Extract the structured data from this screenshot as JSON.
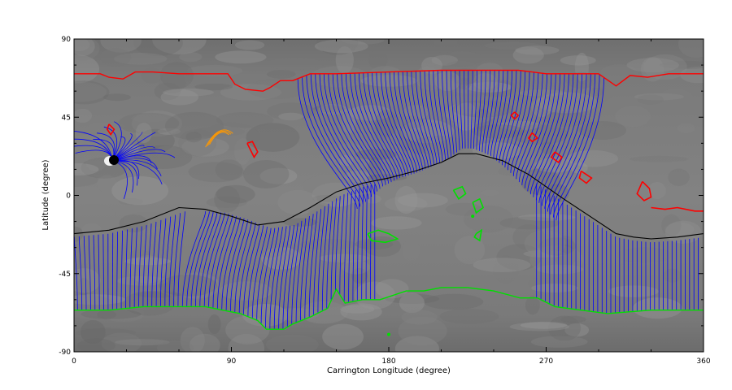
{
  "chart_data": {
    "type": "map-plot",
    "title": "",
    "xlabel": "Carrington Longitude (degree)",
    "ylabel": "Latitude (degree)",
    "xlim": [
      0,
      360
    ],
    "ylim": [
      -90,
      90
    ],
    "xticks": [
      0,
      90,
      180,
      270,
      360
    ],
    "yticks": [
      -90,
      -45,
      0,
      45,
      90
    ],
    "grid": false,
    "background": "grayscale magnetogram",
    "colors": {
      "open_field_lines": "#0000ff",
      "polarity_inversion_line": "#000000",
      "positive_polarity_coronal_hole": "#ff0000",
      "negative_polarity_coronal_hole": "#00e000",
      "closed_loops": "#ff9900"
    },
    "neutral_line": [
      [
        0,
        -22
      ],
      [
        20,
        -20
      ],
      [
        40,
        -15
      ],
      [
        60,
        -7
      ],
      [
        75,
        -8
      ],
      [
        90,
        -12
      ],
      [
        105,
        -17
      ],
      [
        120,
        -15
      ],
      [
        135,
        -7
      ],
      [
        150,
        2
      ],
      [
        165,
        7
      ],
      [
        180,
        10
      ],
      [
        195,
        14
      ],
      [
        210,
        19
      ],
      [
        220,
        24
      ],
      [
        230,
        24
      ],
      [
        245,
        20
      ],
      [
        260,
        12
      ],
      [
        270,
        5
      ],
      [
        280,
        -2
      ],
      [
        295,
        -12
      ],
      [
        310,
        -22
      ],
      [
        320,
        -24
      ],
      [
        330,
        -25
      ],
      [
        345,
        -24
      ],
      [
        360,
        -22
      ]
    ],
    "north_ch_boundary": [
      [
        0,
        70
      ],
      [
        15,
        70
      ],
      [
        20,
        68
      ],
      [
        28,
        67
      ],
      [
        35,
        71
      ],
      [
        45,
        71
      ],
      [
        60,
        70
      ],
      [
        75,
        70
      ],
      [
        88,
        70
      ],
      [
        92,
        64
      ],
      [
        98,
        61
      ],
      [
        108,
        60
      ],
      [
        112,
        62
      ],
      [
        118,
        66
      ],
      [
        125,
        66
      ],
      [
        135,
        70
      ],
      [
        150,
        70
      ],
      [
        180,
        71
      ],
      [
        210,
        72
      ],
      [
        240,
        72
      ],
      [
        254,
        72
      ],
      [
        262,
        71
      ],
      [
        270,
        70
      ],
      [
        285,
        70
      ],
      [
        300,
        70
      ],
      [
        310,
        63
      ],
      [
        318,
        69
      ],
      [
        328,
        68
      ],
      [
        340,
        70
      ],
      [
        360,
        70
      ]
    ],
    "south_ch_boundary": [
      [
        0,
        -66
      ],
      [
        20,
        -66
      ],
      [
        40,
        -64
      ],
      [
        60,
        -64
      ],
      [
        75,
        -64
      ],
      [
        85,
        -66
      ],
      [
        95,
        -68
      ],
      [
        105,
        -72
      ],
      [
        110,
        -77
      ],
      [
        120,
        -77
      ],
      [
        125,
        -74
      ],
      [
        135,
        -70
      ],
      [
        145,
        -65
      ],
      [
        150,
        -54
      ],
      [
        155,
        -62
      ],
      [
        165,
        -60
      ],
      [
        175,
        -60
      ],
      [
        190,
        -55
      ],
      [
        200,
        -55
      ],
      [
        210,
        -53
      ],
      [
        225,
        -53
      ],
      [
        240,
        -55
      ],
      [
        255,
        -59
      ],
      [
        265,
        -59
      ],
      [
        275,
        -64
      ],
      [
        290,
        -66
      ],
      [
        305,
        -68
      ],
      [
        330,
        -66
      ],
      [
        345,
        -66
      ],
      [
        360,
        -66
      ]
    ],
    "red_ch_contours": [
      [
        [
          20,
          41
        ],
        [
          23,
          38
        ],
        [
          21,
          35
        ],
        [
          19,
          38
        ],
        [
          20,
          41
        ]
      ],
      [
        [
          99,
          30
        ],
        [
          101,
          26
        ],
        [
          103,
          22
        ],
        [
          105,
          25
        ],
        [
          102,
          31
        ],
        [
          99,
          30
        ]
      ],
      [
        [
          252,
          48
        ],
        [
          254,
          46
        ],
        [
          252,
          44
        ],
        [
          250,
          46
        ],
        [
          252,
          48
        ]
      ],
      [
        [
          262,
          36
        ],
        [
          265,
          33
        ],
        [
          262,
          31
        ],
        [
          260,
          33
        ],
        [
          262,
          36
        ]
      ],
      [
        [
          275,
          25
        ],
        [
          279,
          22
        ],
        [
          277,
          19
        ],
        [
          273,
          22
        ],
        [
          275,
          25
        ]
      ],
      [
        [
          325,
          8
        ],
        [
          329,
          4
        ],
        [
          330,
          -1
        ],
        [
          326,
          -3
        ],
        [
          322,
          1
        ],
        [
          325,
          8
        ]
      ],
      [
        [
          290,
          14
        ],
        [
          296,
          10
        ],
        [
          293,
          7
        ],
        [
          289,
          10
        ],
        [
          290,
          14
        ]
      ],
      [
        [
          330,
          -7
        ],
        [
          338,
          -8
        ],
        [
          345,
          -7
        ],
        [
          355,
          -9
        ],
        [
          360,
          -9
        ]
      ]
    ],
    "green_ch_contours": [
      [
        [
          217,
          3
        ],
        [
          222,
          5
        ],
        [
          224,
          1
        ],
        [
          220,
          -2
        ],
        [
          217,
          3
        ]
      ],
      [
        [
          228,
          -4
        ],
        [
          232,
          -2
        ],
        [
          234,
          -7
        ],
        [
          230,
          -10
        ],
        [
          228,
          -4
        ]
      ],
      [
        [
          230,
          -22
        ],
        [
          233,
          -20
        ],
        [
          232,
          -26
        ],
        [
          229,
          -24
        ],
        [
          230,
          -22
        ]
      ],
      [
        [
          168,
          -22
        ],
        [
          174,
          -20
        ],
        [
          180,
          -22
        ],
        [
          185,
          -25
        ],
        [
          178,
          -27
        ],
        [
          170,
          -26
        ],
        [
          168,
          -22
        ]
      ],
      [
        [
          180,
          -80
        ]
      ],
      [
        [
          228,
          -12
        ]
      ]
    ],
    "orange_loops": [
      {
        "center": [
          83,
          33
        ],
        "radii": [
          10,
          12,
          14
        ]
      }
    ]
  }
}
